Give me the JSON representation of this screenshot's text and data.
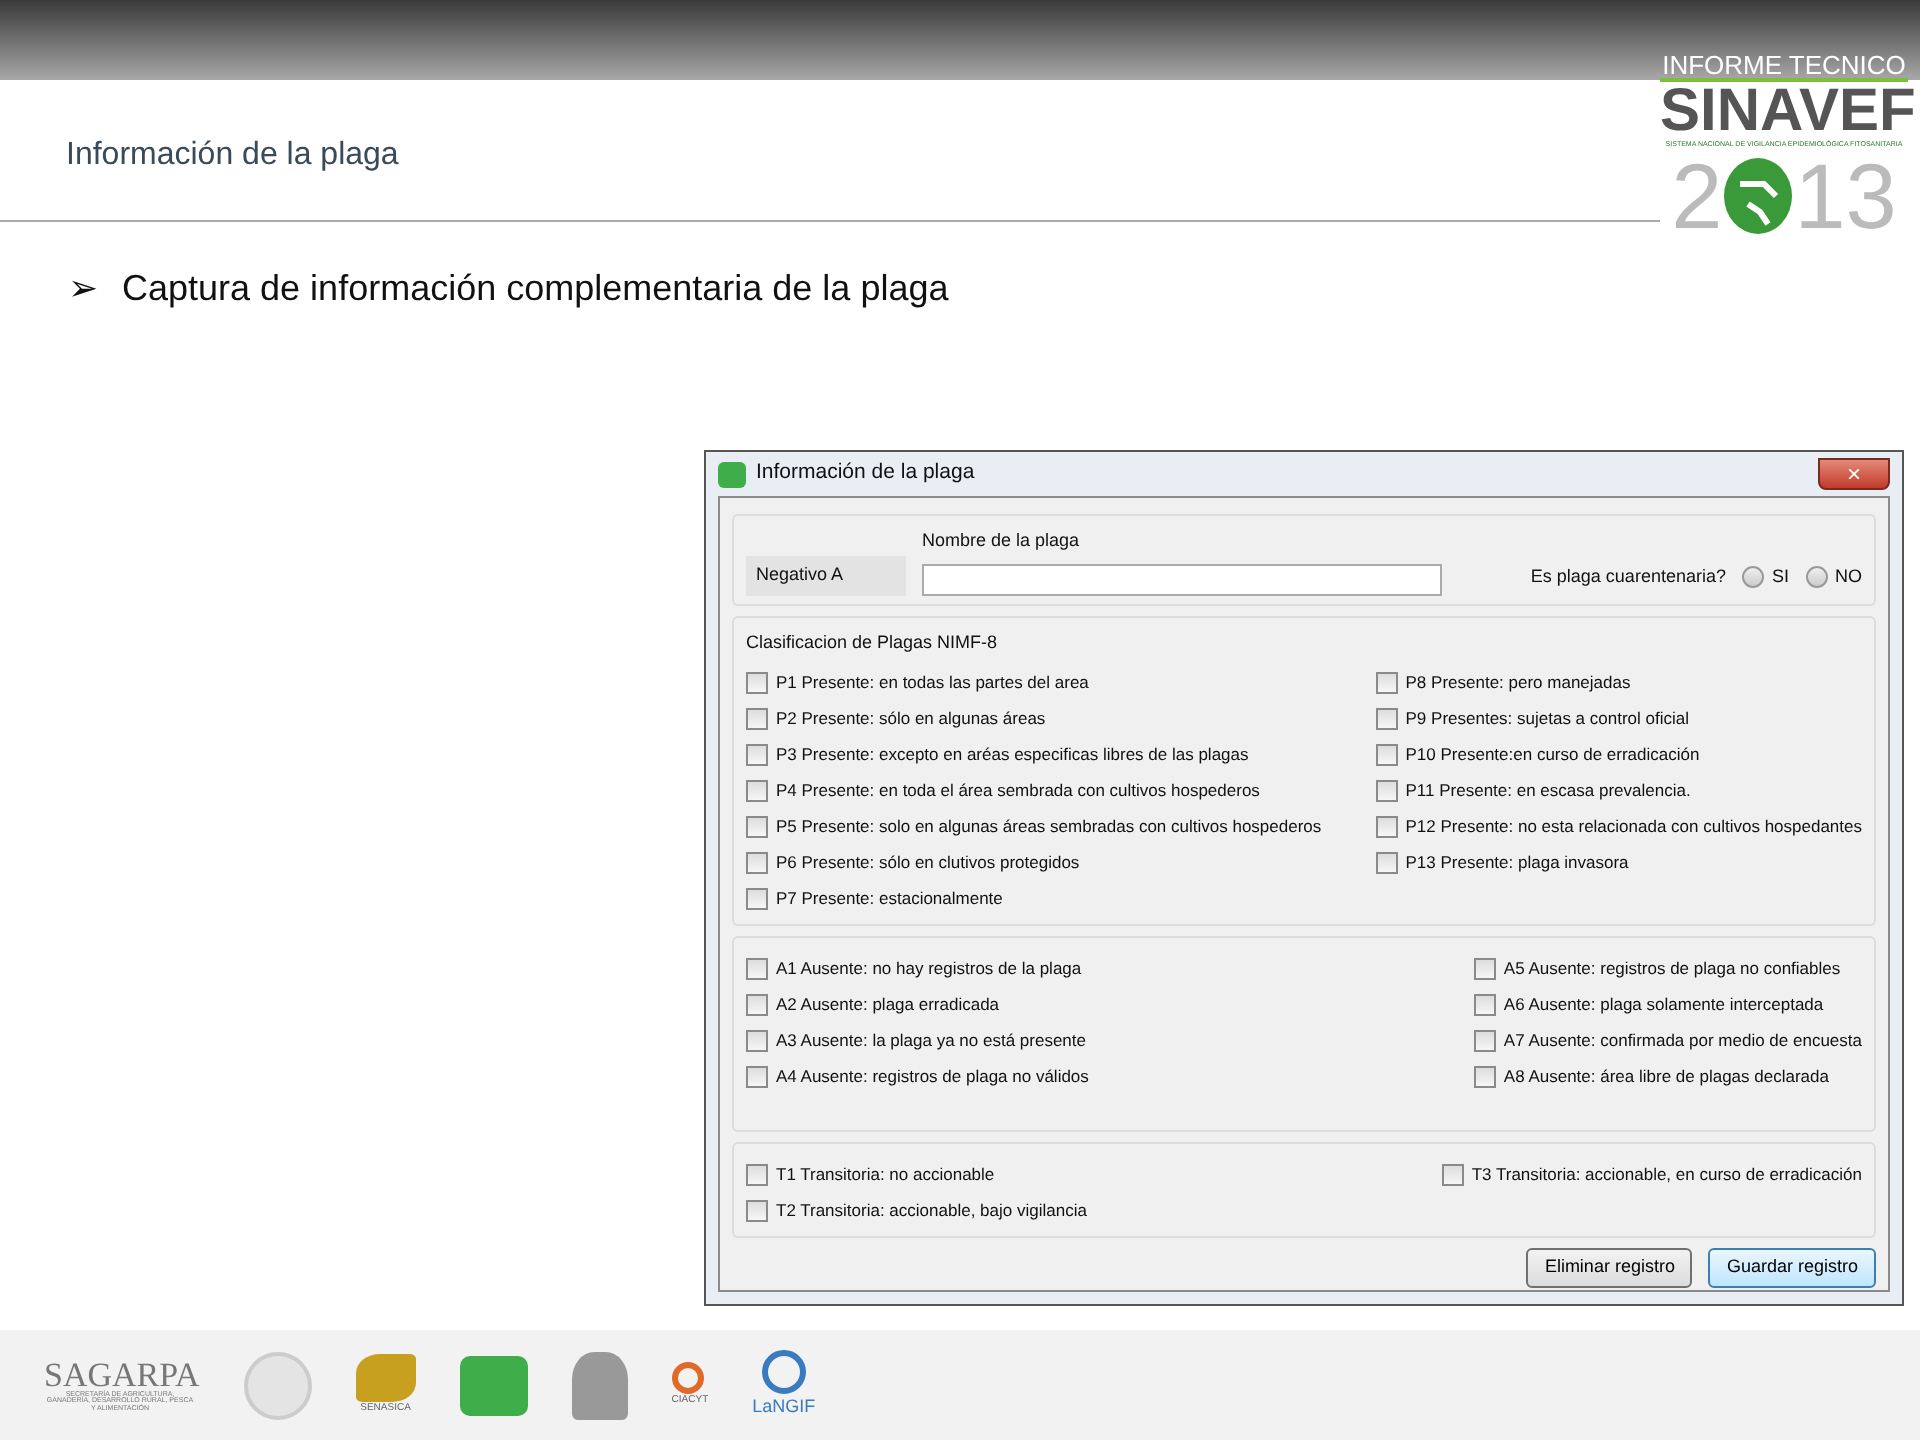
{
  "header": {
    "section_title": "Información de la plaga",
    "logo": {
      "line1": "INFORME TECNICO",
      "brand": "SINAVEF",
      "tagline": "SISTEMA NACIONAL DE VIGILANCIA EPIDEMIOLÓGICA FITOSANITARIA",
      "year_start": "2",
      "year_end": "13"
    }
  },
  "bullet": {
    "marker": "➢",
    "text": "Captura de información complementaria de la plaga"
  },
  "dialog": {
    "title": "Información de la plaga",
    "close": "×",
    "code_value": "Negativo A",
    "name_label": "Nombre de la plaga",
    "quarantine_label": "Es plaga cuarentenaria?",
    "radios": [
      {
        "label": "SI",
        "selected": false
      },
      {
        "label": "NO",
        "selected": false
      }
    ],
    "groups": [
      {
        "legend": "Clasificacion de Plagas NIMF-8",
        "columns": [
          [
            {
              "label": "P1 Presente: en todas las partes del area",
              "checked": false
            },
            {
              "label": "P2 Presente: sólo en algunas áreas",
              "checked": false
            },
            {
              "label": "P3 Presente: excepto en aréas especificas libres de las plagas",
              "checked": false
            },
            {
              "label": "P4 Presente: en toda el área sembrada con cultivos hospederos",
              "checked": false
            },
            {
              "label": "P5 Presente: solo en algunas áreas sembradas con cultivos hospederos",
              "checked": false
            },
            {
              "label": "P6 Presente: sólo en clutivos protegidos",
              "checked": false
            },
            {
              "label": "P7 Presente: estacionalmente",
              "checked": false
            }
          ],
          [
            {
              "label": "P8 Presente: pero manejadas",
              "checked": false
            },
            {
              "label": "P9 Presentes: sujetas a control oficial",
              "checked": false
            },
            {
              "label": "P10 Presente:en curso de erradicación",
              "checked": false
            },
            {
              "label": "P11 Presente: en escasa prevalencia.",
              "checked": false
            },
            {
              "label": "P12 Presente: no esta relacionada con cultivos hospedantes",
              "checked": false
            },
            {
              "label": "P13 Presente: plaga invasora",
              "checked": false
            }
          ]
        ]
      },
      {
        "columns": [
          [
            {
              "label": "A1 Ausente: no hay registros de la plaga",
              "checked": false
            },
            {
              "label": "A2 Ausente: plaga erradicada",
              "checked": false
            },
            {
              "label": "A3 Ausente: la plaga ya no está presente",
              "checked": false
            },
            {
              "label": "A4 Ausente: registros de plaga no válidos",
              "checked": false
            }
          ],
          [
            {
              "label": "A5 Ausente: registros de plaga no confiables",
              "checked": false
            },
            {
              "label": "A6 Ausente: plaga solamente interceptada",
              "checked": false
            },
            {
              "label": "A7 Ausente: confirmada por medio de encuesta",
              "checked": false
            },
            {
              "label": "A8 Ausente: área libre de plagas declarada",
              "checked": false
            }
          ]
        ]
      },
      {
        "columns": [
          [
            {
              "label": "T1 Transitoria: no accionable",
              "checked": false
            },
            {
              "label": "T2 Transitoria: accionable, bajo vigilancia",
              "checked": false
            }
          ],
          [
            {
              "label": "T3 Transitoria: accionable, en curso de erradicación",
              "checked": false
            }
          ]
        ]
      }
    ],
    "buttons": [
      {
        "label": "Eliminar registro",
        "default": false
      },
      {
        "label": "Guardar registro",
        "default": true
      }
    ]
  },
  "footer": {
    "sagarpa": "SAGARPA",
    "sagarpa_sub": "SECRETARÍA DE AGRICULTURA, GANADERÍA, DESARROLLO RURAL, PESCA Y ALIMENTACIÓN",
    "senasica": "SENASICA",
    "ciacyt": "CIACYT",
    "langif": "LaNGIF"
  }
}
